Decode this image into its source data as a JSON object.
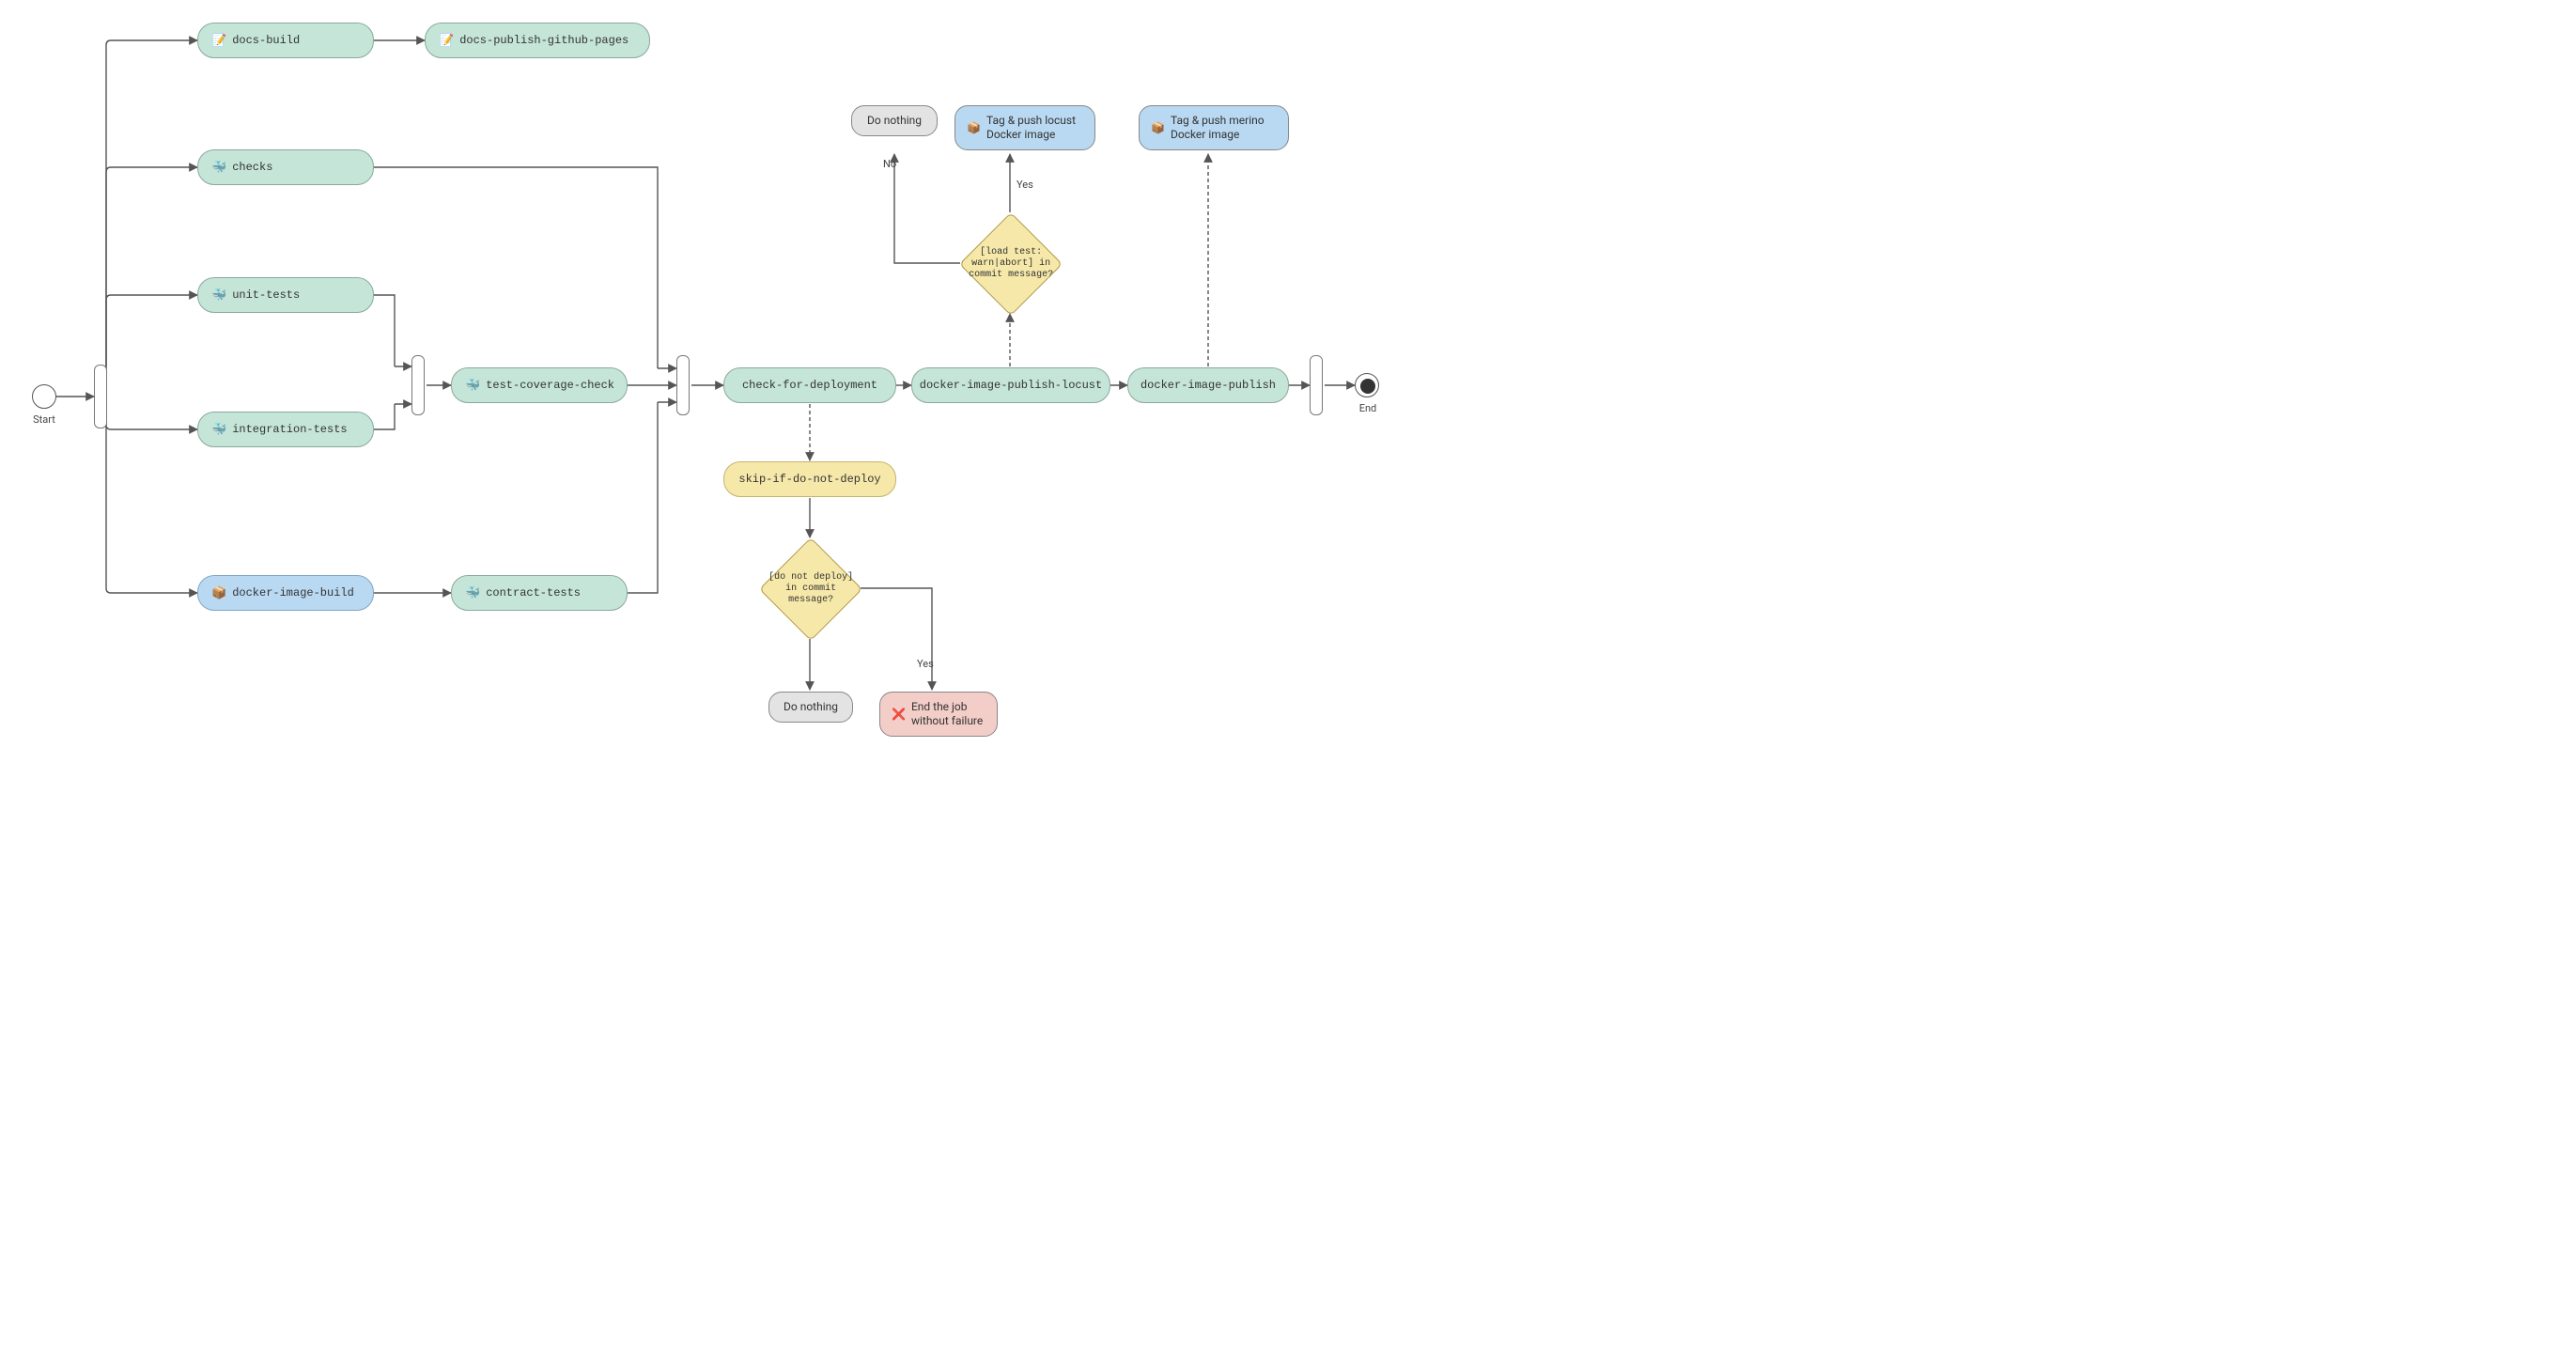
{
  "chart_data": {
    "type": "flowchart",
    "title": "",
    "nodes": [
      {
        "id": "start",
        "kind": "start",
        "label": "Start"
      },
      {
        "id": "fork1",
        "kind": "parallel-gateway"
      },
      {
        "id": "docs-build",
        "kind": "job",
        "color": "green",
        "icon": "📝",
        "label": "docs-build"
      },
      {
        "id": "docs-pub",
        "kind": "job",
        "color": "green",
        "icon": "📝",
        "label": "docs-publish-github-pages"
      },
      {
        "id": "checks",
        "kind": "job",
        "color": "green",
        "icon": "🐳",
        "label": "checks"
      },
      {
        "id": "unit",
        "kind": "job",
        "color": "green",
        "icon": "🐳",
        "label": "unit-tests"
      },
      {
        "id": "integ",
        "kind": "job",
        "color": "green",
        "icon": "🐳",
        "label": "integration-tests"
      },
      {
        "id": "dimg",
        "kind": "job",
        "color": "blue",
        "icon": "📦",
        "label": "docker-image-build"
      },
      {
        "id": "fork2",
        "kind": "parallel-gateway"
      },
      {
        "id": "cov",
        "kind": "job",
        "color": "green",
        "icon": "🐳",
        "label": "test-coverage-check"
      },
      {
        "id": "contract",
        "kind": "job",
        "color": "green",
        "icon": "🐳",
        "label": "contract-tests"
      },
      {
        "id": "join1",
        "kind": "parallel-gateway"
      },
      {
        "id": "checkdep",
        "kind": "job",
        "color": "green",
        "icon": "",
        "label": "check-for-deployment"
      },
      {
        "id": "skip",
        "kind": "job",
        "color": "yellow",
        "icon": "",
        "label": "skip-if-do-not-deploy"
      },
      {
        "id": "dec-dnd",
        "kind": "decision",
        "label": "[do not deploy] in commit message?"
      },
      {
        "id": "dn1",
        "kind": "action",
        "color": "grey",
        "label": "Do nothing"
      },
      {
        "id": "endjob",
        "kind": "action",
        "color": "red",
        "icon": "❌",
        "label": "End the job without failure"
      },
      {
        "id": "publocust",
        "kind": "job",
        "color": "green",
        "icon": "",
        "label": "docker-image-publish-locust"
      },
      {
        "id": "dec-load",
        "kind": "decision",
        "label": "[load test: warn|abort] in commit message?"
      },
      {
        "id": "dn2",
        "kind": "action",
        "color": "grey",
        "label": "Do nothing"
      },
      {
        "id": "tag-locust",
        "kind": "action",
        "color": "blue",
        "icon": "📦",
        "label": "Tag & push locust Docker image"
      },
      {
        "id": "pubmerino",
        "kind": "job",
        "color": "green",
        "icon": "",
        "label": "docker-image-publish"
      },
      {
        "id": "tag-merino",
        "kind": "action",
        "color": "blue",
        "icon": "📦",
        "label": "Tag & push merino Docker image"
      },
      {
        "id": "join2",
        "kind": "parallel-gateway"
      },
      {
        "id": "end",
        "kind": "end",
        "label": "End"
      }
    ],
    "edges": [
      {
        "from": "start",
        "to": "fork1"
      },
      {
        "from": "fork1",
        "to": "docs-build"
      },
      {
        "from": "fork1",
        "to": "checks"
      },
      {
        "from": "fork1",
        "to": "unit"
      },
      {
        "from": "fork1",
        "to": "integ"
      },
      {
        "from": "fork1",
        "to": "dimg"
      },
      {
        "from": "docs-build",
        "to": "docs-pub"
      },
      {
        "from": "unit",
        "to": "fork2"
      },
      {
        "from": "integ",
        "to": "fork2"
      },
      {
        "from": "fork2",
        "to": "cov"
      },
      {
        "from": "dimg",
        "to": "contract"
      },
      {
        "from": "checks",
        "to": "join1"
      },
      {
        "from": "cov",
        "to": "join1"
      },
      {
        "from": "contract",
        "to": "join1"
      },
      {
        "from": "join1",
        "to": "checkdep"
      },
      {
        "from": "checkdep",
        "to": "skip",
        "style": "dashed"
      },
      {
        "from": "skip",
        "to": "dec-dnd"
      },
      {
        "from": "dec-dnd",
        "to": "dn1"
      },
      {
        "from": "dec-dnd",
        "to": "endjob",
        "label": "Yes"
      },
      {
        "from": "checkdep",
        "to": "publocust"
      },
      {
        "from": "publocust",
        "to": "dec-load",
        "style": "dashed"
      },
      {
        "from": "dec-load",
        "to": "dn2",
        "label": "No"
      },
      {
        "from": "dec-load",
        "to": "tag-locust",
        "label": "Yes"
      },
      {
        "from": "publocust",
        "to": "pubmerino"
      },
      {
        "from": "pubmerino",
        "to": "tag-merino",
        "style": "dashed"
      },
      {
        "from": "pubmerino",
        "to": "join2"
      },
      {
        "from": "join2",
        "to": "end"
      }
    ],
    "edge_labels": {
      "yes": "Yes",
      "no": "No"
    }
  },
  "labels": {
    "start": "Start",
    "end": "End"
  }
}
